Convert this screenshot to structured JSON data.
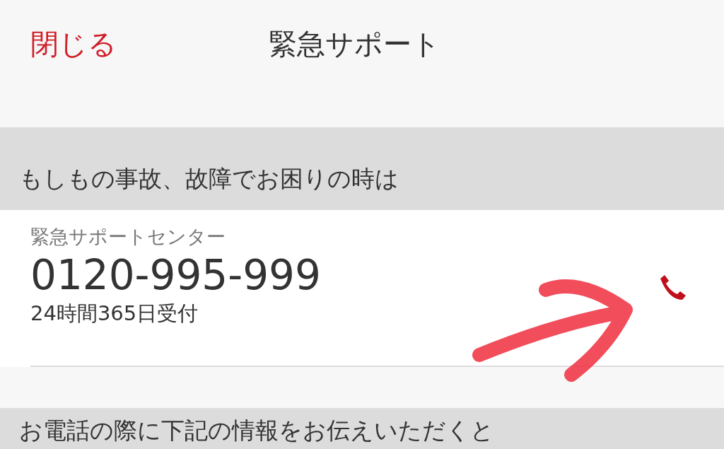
{
  "header": {
    "close": "閉じる",
    "title": "緊急サポート"
  },
  "sections": [
    {
      "heading": "もしもの事故、故障でお困りの時は",
      "contact": {
        "label": "緊急サポートセンター",
        "phone": "0120-995-999",
        "hours": "24時間365日受付"
      }
    },
    {
      "heading": "お電話の際に下記の情報をお伝えいただくと"
    }
  ],
  "annotation": {
    "kind": "arrow"
  }
}
